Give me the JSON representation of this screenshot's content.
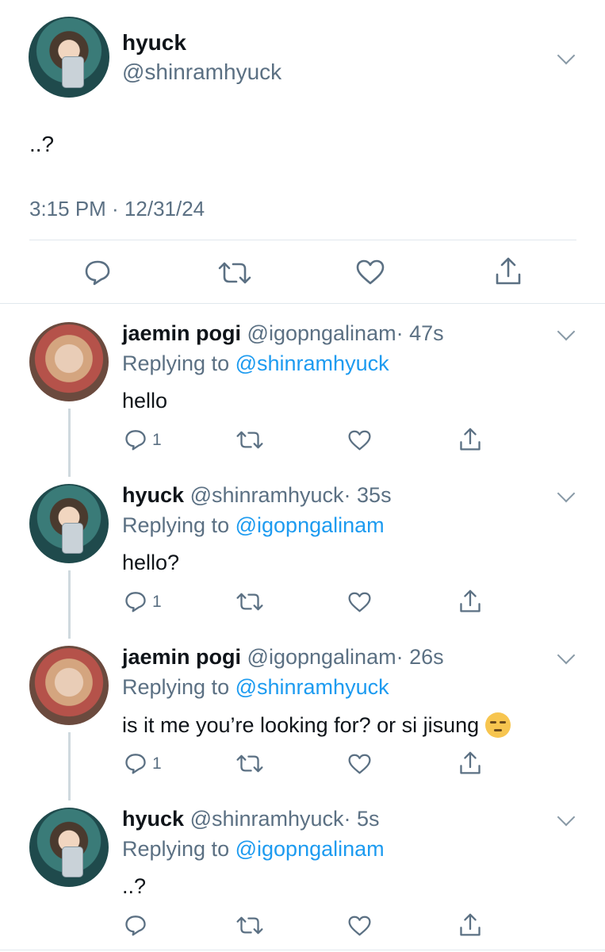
{
  "main_tweet": {
    "display_name": "hyuck",
    "handle": "@shinramhyuck",
    "text": "..?",
    "timestamp": "3:15 PM · 12/31/24",
    "actions": [
      "reply-icon",
      "retweet-icon",
      "like-icon",
      "share-icon"
    ]
  },
  "replies": [
    {
      "display_name": "jaemin pogi",
      "handle": "@igopngalinam",
      "time": "· 47s",
      "replying_prefix": "Replying to",
      "replying_handle": "@shinramhyuck",
      "text": "hello",
      "reply_count": "1"
    },
    {
      "display_name": "hyuck",
      "handle": "@shinramhyuck",
      "time": "· 35s",
      "replying_prefix": "Replying to",
      "replying_handle": "@igopngalinam",
      "text": "hello?",
      "reply_count": "1"
    },
    {
      "display_name": "jaemin pogi",
      "handle": "@igopngalinam",
      "time": "· 26s",
      "replying_prefix": "Replying to",
      "replying_handle": "@shinramhyuck",
      "text": "is it me you’re looking for? or si jisung",
      "emoji": "unamused-face-emoji",
      "reply_count": "1"
    },
    {
      "display_name": "hyuck",
      "handle": "@shinramhyuck",
      "time": "· 5s",
      "replying_prefix": "Replying to",
      "replying_handle": "@igopngalinam",
      "text": "..?",
      "reply_count": ""
    }
  ],
  "colors": {
    "link": "#1d9bf0",
    "muted": "#5b7083",
    "icon": "#5b7083",
    "divider": "#e1e8ed"
  }
}
